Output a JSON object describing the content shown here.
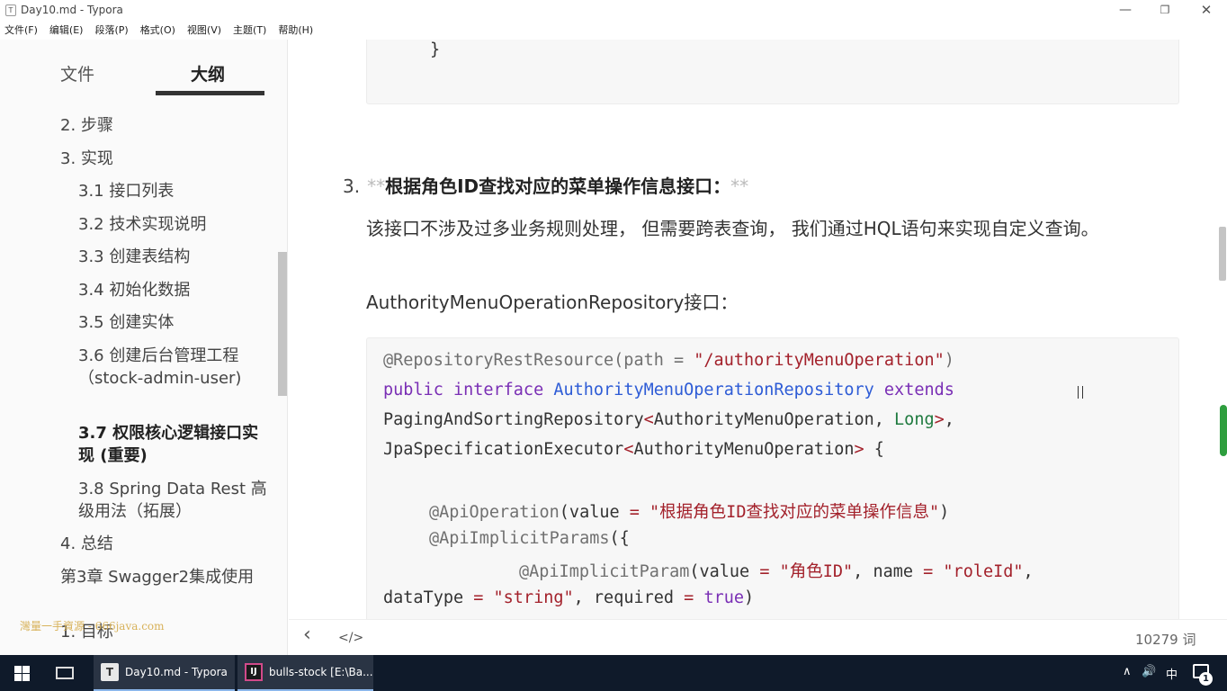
{
  "window": {
    "app_icon": "T",
    "title": "Day10.md - Typora",
    "minimize": "—",
    "maximize": "❐",
    "close": "✕"
  },
  "menu": [
    "文件(F)",
    "编辑(E)",
    "段落(P)",
    "格式(O)",
    "视图(V)",
    "主题(T)",
    "帮助(H)"
  ],
  "sidebar": {
    "tab_files": "文件",
    "tab_outline": "大纲",
    "outline": [
      {
        "text": "2. 步骤"
      },
      {
        "text": "3. 实现"
      },
      {
        "text": "3.1 接口列表"
      },
      {
        "text": "3.2 技术实现说明"
      },
      {
        "text": "3.3 创建表结构"
      },
      {
        "text": "3.4 初始化数据"
      },
      {
        "text": "3.5 创建实体"
      },
      {
        "text": "3.6 创建后台管理工程（stock-admin-user)"
      },
      {
        "text": "3.7 权限核心逻辑接口实现 (重要)"
      },
      {
        "text": "3.8 Spring Data Rest 高级用法（拓展）"
      },
      {
        "text": "4. 总结"
      },
      {
        "text": "第3章 Swagger2集成使用"
      },
      {
        "text": "1. 目标"
      }
    ],
    "watermark": "灣量一手資源 - 666java.com"
  },
  "editor": {
    "code_top_line": "}",
    "heading_num": "3.",
    "heading_stars_open": "**",
    "heading_text": "根据角色ID查找对应的菜单操作信息接口：",
    "heading_stars_close": "**",
    "paragraph": "该接口不涉及过多业务规则处理， 但需要跨表查询， 我们通过HQL语句来实现自定义查询。",
    "interface_label": "AuthorityMenuOperationRepository接口：",
    "code": {
      "l1_ann": "@RepositoryRestResource(path = ",
      "l1_str": "\"/authorityMenuOperation\"",
      "l1_end": ")",
      "l2_kw1": "public",
      "l2_kw2": "interface",
      "l2_cls": "AuthorityMenuOperationRepository",
      "l2_kw3": "extends",
      "l3_a": "PagingAndSortingRepository",
      "l3_lt": "<",
      "l3_b": "AuthorityMenuOperation, ",
      "l3_typ": "Long",
      "l3_gt": ">",
      "l3_c": ",",
      "l4_a": "JpaSpecificationExecutor",
      "l4_lt": "<",
      "l4_b": "AuthorityMenuOperation",
      "l4_gt": ">",
      "l4_c": " {",
      "l5_ann": "@ApiOperation",
      "l5_a": "(value ",
      "l5_eq": "=",
      "l5_sp": " ",
      "l5_str": "\"根据角色ID查找对应的菜单操作信息\"",
      "l5_end": ")",
      "l6_ann": "@ApiImplicitParams",
      "l6_a": "({",
      "l7_ann": "@ApiImplicitParam",
      "l7_a": "(value ",
      "l7_eq": "=",
      "l7_sp": " ",
      "l7_str": "\"角色ID\"",
      "l7_b": ", name ",
      "l7_eq2": "=",
      "l7_sp2": " ",
      "l7_str2": "\"roleId\"",
      "l7_c": ",",
      "l8_a": "dataType ",
      "l8_eq": "=",
      "l8_sp": " ",
      "l8_str": "\"string\"",
      "l8_b": ", required ",
      "l8_eq2": "=",
      "l8_sp2": " ",
      "l8_kw": "true",
      "l8_c": ")"
    }
  },
  "status": {
    "back_icon": "‹",
    "source_icon": "</>",
    "word_count": "10279 词"
  },
  "taskbar": {
    "typora_icon": "T",
    "typora_label": "Day10.md - Typora",
    "ij_icon": "IJ",
    "ij_label": "bulls-stock [E:\\Ba...",
    "tray_chevron": "∧",
    "tray_volume": "🔊",
    "tray_ime": "中",
    "notif_count": "1"
  }
}
